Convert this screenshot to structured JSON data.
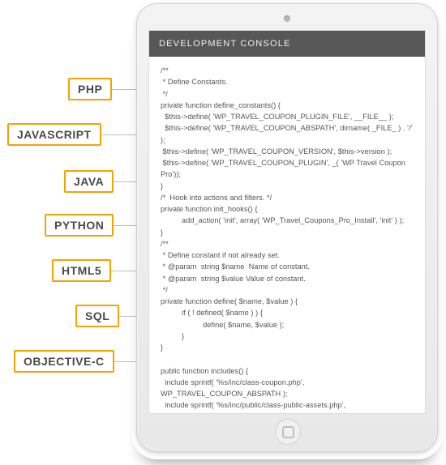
{
  "tags": {
    "php": "PHP",
    "js": "JAVASCRIPT",
    "java": "JAVA",
    "python": "PYTHON",
    "html5": "HTML5",
    "sql": "SQL",
    "objc": "OBJECTIVE-C"
  },
  "console": {
    "title": "DEVELOPMENT CONSOLE",
    "code": "/**\n * Define Constants.\n */\nprivate function define_constants() {\n  $this->define( 'WP_TRAVEL_COUPON_PLUGIN_FILE', __FILE__ );\n  $this->define( 'WP_TRAVEL_COUPON_ABSPATH', dirname( _FILE_ ) . '/' );\n $this->define( 'WP_TRAVEL_COUPON_VERSION', $this->version );\n $this->define( 'WP_TRAVEL_COUPON_PLUGIN', _( 'WP Travel Coupon Pro'));\n}\n/*  Hook into actions and filters. */\nprivate function init_hooks() {\n          add_action( 'init', array( 'WP_Travel_Coupons_Pro_Install', 'init' ) );\n}\n/**\n * Define constant if not already set.\n * @param  string $name  Name of constant.\n * @param  string $value Value of constant.\n */\nprivate function define( $name, $value ) {\n          if ( ! defined( $name ) ) {\n                    define( $name, $value );\n          }\n}\n\npublic function includes() {\n  include sprintf( '%s/inc/class-coupon.php', WP_TRAVEL_COUPON_ABSPATH );\n  include sprintf( '%s/inc/public/class-public-assets.php', WP_TRAVEL_COUPON_PRO_ABSPATH );"
  }
}
